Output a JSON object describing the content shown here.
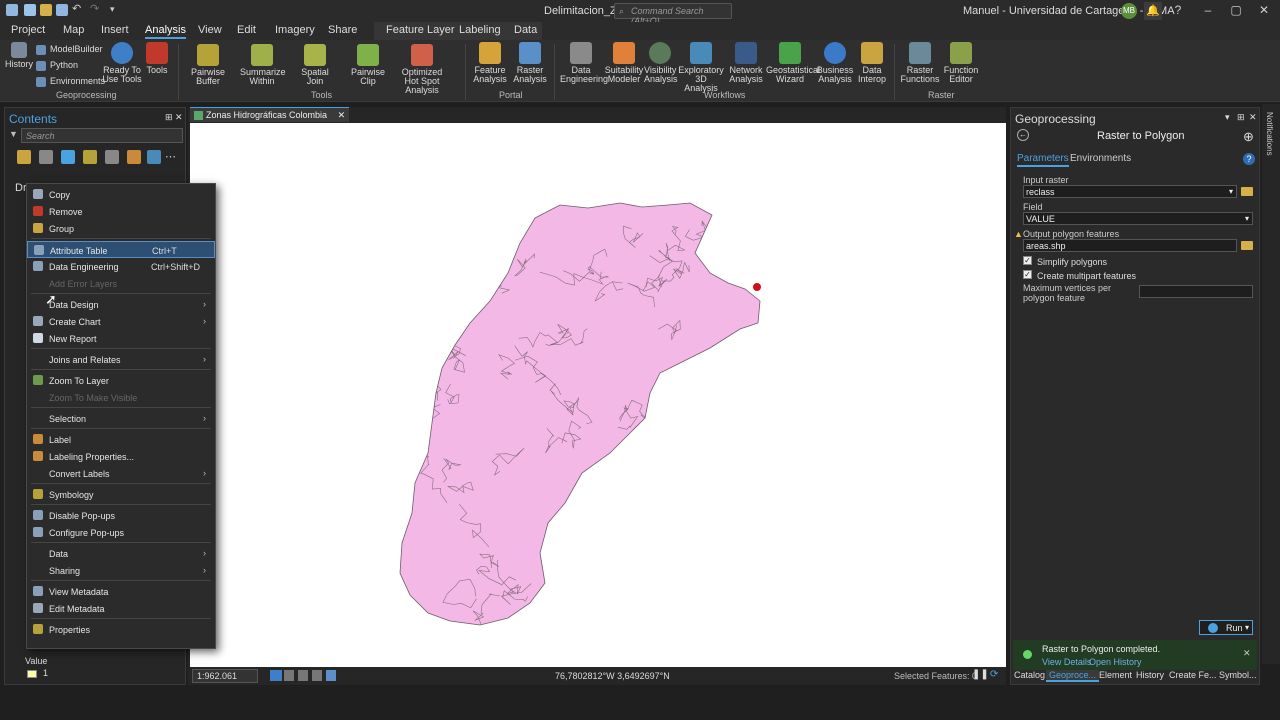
{
  "titlebar": {
    "doc_title": "Delimitacion_ZH",
    "search_placeholder": "Command Search (Alt+Q)",
    "user": "Manuel - Universidad de Cartagena - GIMA",
    "avatar_initials": "MB",
    "help": "?",
    "minimize": "–",
    "maximize": "▢",
    "close": "✕"
  },
  "menu_tabs": [
    "Project",
    "Map",
    "Insert",
    "Analysis",
    "View",
    "Edit",
    "Imagery",
    "Share",
    "Feature Layer",
    "Labeling",
    "Data"
  ],
  "active_tab": "Analysis",
  "ribbon": {
    "geoprocessing": {
      "history": "History",
      "modelbuilder": "ModelBuilder",
      "python": "Python",
      "environments": "Environments",
      "ready_tools": "Ready To Use Tools",
      "tools": "Tools",
      "group_label": "Geoprocessing"
    },
    "tools": [
      {
        "label": "Pairwise Buffer"
      },
      {
        "label": "Summarize Within"
      },
      {
        "label": "Spatial Join"
      },
      {
        "label": "Pairwise Clip"
      },
      {
        "label": "Optimized Hot Spot Analysis"
      }
    ],
    "tools_group": "Tools",
    "portal": [
      {
        "label": "Feature Analysis"
      },
      {
        "label": "Raster Analysis"
      }
    ],
    "portal_group": "Portal",
    "workflows": [
      {
        "label": "Data Engineering"
      },
      {
        "label": "Suitability Modeler"
      },
      {
        "label": "Visibility Analysis"
      },
      {
        "label": "Exploratory 3D Analysis"
      },
      {
        "label": "Network Analysis"
      },
      {
        "label": "Geostatistical Wizard"
      },
      {
        "label": "Business Analysis"
      },
      {
        "label": "Data Interop"
      }
    ],
    "workflows_group": "Workflows",
    "raster": [
      {
        "label": "Raster Functions"
      },
      {
        "label": "Function Editor"
      }
    ],
    "raster_group": "Raster"
  },
  "contents": {
    "title": "Contents",
    "search_placeholder": "Search",
    "drawing_order_label": "Dr",
    "legend_label": "Value",
    "legend_value": "1",
    "pin": "⊟",
    "close": "✕"
  },
  "context_menu": {
    "items": [
      {
        "label": "Copy",
        "shortcut": "",
        "submenu": false,
        "disabled": false,
        "highlight": false,
        "icon_color": "#9aa7b8"
      },
      {
        "label": "Remove",
        "shortcut": "",
        "submenu": false,
        "disabled": false,
        "highlight": false,
        "icon_color": "#c0392b"
      },
      {
        "label": "Group",
        "shortcut": "",
        "submenu": false,
        "disabled": false,
        "highlight": false,
        "icon_color": "#c9a441"
      },
      {
        "label": "Attribute Table",
        "shortcut": "Ctrl+T",
        "submenu": false,
        "disabled": false,
        "highlight": true,
        "icon_color": "#8aa0b8"
      },
      {
        "label": "Data Engineering",
        "shortcut": "Ctrl+Shift+D",
        "submenu": false,
        "disabled": false,
        "highlight": false,
        "icon_color": "#8aa0b8"
      },
      {
        "label": "Add Error Layers",
        "shortcut": "",
        "submenu": false,
        "disabled": true,
        "highlight": false,
        "icon_color": ""
      },
      {
        "label": "Data Design",
        "shortcut": "",
        "submenu": true,
        "disabled": false,
        "highlight": false,
        "icon_color": ""
      },
      {
        "label": "Create Chart",
        "shortcut": "",
        "submenu": true,
        "disabled": false,
        "highlight": false,
        "icon_color": "#9aa7b8"
      },
      {
        "label": "New Report",
        "shortcut": "",
        "submenu": false,
        "disabled": false,
        "highlight": false,
        "icon_color": "#cfd8e3"
      },
      {
        "label": "Joins and Relates",
        "shortcut": "",
        "submenu": true,
        "disabled": false,
        "highlight": false,
        "icon_color": ""
      },
      {
        "label": "Zoom To Layer",
        "shortcut": "",
        "submenu": false,
        "disabled": false,
        "highlight": false,
        "icon_color": "#6f9a4a"
      },
      {
        "label": "Zoom To Make Visible",
        "shortcut": "",
        "submenu": false,
        "disabled": true,
        "highlight": false,
        "icon_color": ""
      },
      {
        "label": "Selection",
        "shortcut": "",
        "submenu": true,
        "disabled": false,
        "highlight": false,
        "icon_color": ""
      },
      {
        "label": "Label",
        "shortcut": "",
        "submenu": false,
        "disabled": false,
        "highlight": false,
        "icon_color": "#c98a3a"
      },
      {
        "label": "Labeling Properties...",
        "shortcut": "",
        "submenu": false,
        "disabled": false,
        "highlight": false,
        "icon_color": "#c98a3a"
      },
      {
        "label": "Convert Labels",
        "shortcut": "",
        "submenu": true,
        "disabled": false,
        "highlight": false,
        "icon_color": ""
      },
      {
        "label": "Symbology",
        "shortcut": "",
        "submenu": false,
        "disabled": false,
        "highlight": false,
        "icon_color": "#b5a33a"
      },
      {
        "label": "Disable Pop-ups",
        "shortcut": "",
        "submenu": false,
        "disabled": false,
        "highlight": false,
        "icon_color": "#8aa0b8"
      },
      {
        "label": "Configure Pop-ups",
        "shortcut": "",
        "submenu": false,
        "disabled": false,
        "highlight": false,
        "icon_color": "#8aa0b8"
      },
      {
        "label": "Data",
        "shortcut": "",
        "submenu": true,
        "disabled": false,
        "highlight": false,
        "icon_color": ""
      },
      {
        "label": "Sharing",
        "shortcut": "",
        "submenu": true,
        "disabled": false,
        "highlight": false,
        "icon_color": ""
      },
      {
        "label": "View Metadata",
        "shortcut": "",
        "submenu": false,
        "disabled": false,
        "highlight": false,
        "icon_color": "#8aa0b8"
      },
      {
        "label": "Edit Metadata",
        "shortcut": "",
        "submenu": false,
        "disabled": false,
        "highlight": false,
        "icon_color": "#9aa7b8"
      },
      {
        "label": "Properties",
        "shortcut": "",
        "submenu": false,
        "disabled": false,
        "highlight": false,
        "icon_color": "#b5a33a"
      }
    ]
  },
  "map": {
    "tab_label": "Zonas Hidrográficas Colombia",
    "tab_close": "✕",
    "scale": "1:962.061",
    "coords": "76,7802812°W 3,6492697°N",
    "selected_features": "Selected Features: 0",
    "fill_color": "#f3b8e6",
    "outline_color": "#6e5a6a",
    "point_color": "#d0101e"
  },
  "geoprocessing": {
    "panel_title": "Geoprocessing",
    "tool_name": "Raster to Polygon",
    "tab_parameters": "Parameters",
    "tab_environments": "Environments",
    "input_raster_label": "Input raster",
    "input_raster_value": "reclass",
    "field_label": "Field",
    "field_value": "VALUE",
    "output_label": "Output polygon features",
    "output_value": "areas.shp",
    "simplify_label": "Simplify polygons",
    "multipart_label": "Create multipart features",
    "max_vertices_label": "Maximum vertices per polygon feature",
    "run_label": "Run",
    "notification": "Raster to Polygon completed.",
    "view_details": "View Details",
    "open_history": "Open History"
  },
  "bottom_tabs": [
    "Catalog",
    "Geoproce...",
    "Element",
    "History",
    "Create Fe...",
    "Symbol..."
  ],
  "notifications_strip": "Notifications"
}
